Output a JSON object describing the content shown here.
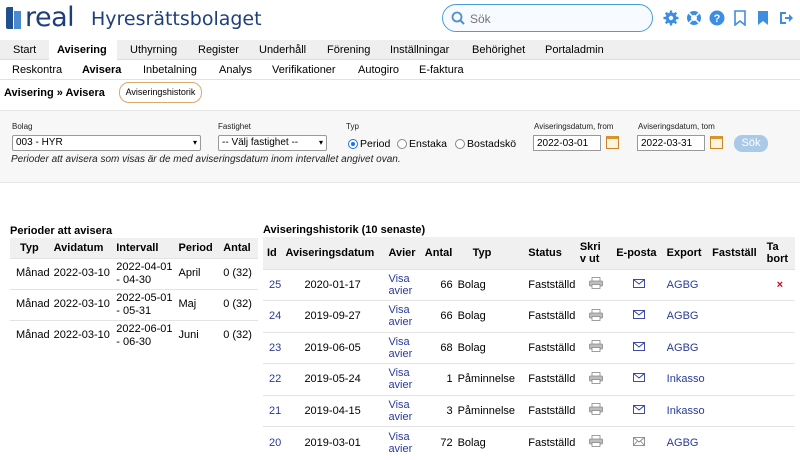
{
  "header": {
    "logo_text": "real",
    "app_title": "Hyresrättsbolaget",
    "search_placeholder": "Sök"
  },
  "nav_main": [
    "Start",
    "Avisering",
    "Uthyrning",
    "Register",
    "Underhåll",
    "Förening",
    "Inställningar",
    "Behörighet",
    "Portaladmin"
  ],
  "nav_main_active": "Avisering",
  "nav_sub": [
    "Reskontra",
    "Avisera",
    "Inbetalning",
    "Analys",
    "Verifikationer",
    "Autogiro",
    "E-faktura"
  ],
  "nav_sub_active": "Avisera",
  "breadcrumb": "Avisering » Avisera",
  "history_button": "Aviseringshistorik",
  "filters": {
    "bolag_label": "Bolag",
    "bolag_value": "003 - HYR",
    "fastighet_label": "Fastighet",
    "fastighet_value": "-- Välj fastighet --",
    "typ_label": "Typ",
    "typ_options": [
      "Period",
      "Enstaka",
      "Bostadskö"
    ],
    "typ_selected": "Period",
    "from_label": "Aviseringsdatum, from",
    "from_value": "2022-03-01",
    "tom_label": "Aviseringsdatum, tom",
    "tom_value": "2022-03-31",
    "search_button": "Sök",
    "note": "Perioder att avisera som visas är de med aviseringsdatum inom intervallet angivet ovan."
  },
  "periods": {
    "title": "Perioder att avisera",
    "columns": [
      "Typ",
      "Avidatum",
      "Intervall",
      "Period",
      "Antal"
    ],
    "rows": [
      {
        "typ": "Månad",
        "avidatum": "2022-03-10",
        "intervall_1": "2022-04-01",
        "intervall_2": "- 04-30",
        "period": "April",
        "antal": "0 (32)"
      },
      {
        "typ": "Månad",
        "avidatum": "2022-03-10",
        "intervall_1": "2022-05-01",
        "intervall_2": "- 05-31",
        "period": "Maj",
        "antal": "0 (32)"
      },
      {
        "typ": "Månad",
        "avidatum": "2022-03-10",
        "intervall_1": "2022-06-01",
        "intervall_2": "- 06-30",
        "period": "Juni",
        "antal": "0 (32)"
      }
    ]
  },
  "history": {
    "title": "Aviseringshistorik (10 senaste)",
    "columns": [
      "Id",
      "Aviseringsdatum",
      "Avier",
      "Antal",
      "Typ",
      "Status",
      "Skriv ut",
      "E-posta",
      "Export",
      "Fastställ",
      "Ta bort"
    ],
    "rows": [
      {
        "id": "25",
        "datum": "2020-01-17",
        "avier_1": "Visa",
        "avier_2": "avier",
        "antal": "66",
        "typ": "Bolag",
        "status": "Fastställd",
        "export": "AGBG",
        "delete": "×"
      },
      {
        "id": "24",
        "datum": "2019-09-27",
        "avier_1": "Visa",
        "avier_2": "avier",
        "antal": "66",
        "typ": "Bolag",
        "status": "Fastställd",
        "export": "AGBG",
        "delete": ""
      },
      {
        "id": "23",
        "datum": "2019-06-05",
        "avier_1": "Visa",
        "avier_2": "avier",
        "antal": "68",
        "typ": "Bolag",
        "status": "Fastställd",
        "export": "AGBG",
        "delete": ""
      },
      {
        "id": "22",
        "datum": "2019-05-24",
        "avier_1": "Visa",
        "avier_2": "avier",
        "antal": "1",
        "typ": "Påminnelse",
        "status": "Fastställd",
        "export": "Inkasso",
        "delete": ""
      },
      {
        "id": "21",
        "datum": "2019-04-15",
        "avier_1": "Visa",
        "avier_2": "avier",
        "antal": "3",
        "typ": "Påminnelse",
        "status": "Fastställd",
        "export": "Inkasso",
        "delete": ""
      },
      {
        "id": "20",
        "datum": "2019-03-01",
        "avier_1": "Visa",
        "avier_2": "avier",
        "antal": "72",
        "typ": "Bolag",
        "status": "Fastställd",
        "export": "AGBG",
        "delete": ""
      }
    ]
  }
}
